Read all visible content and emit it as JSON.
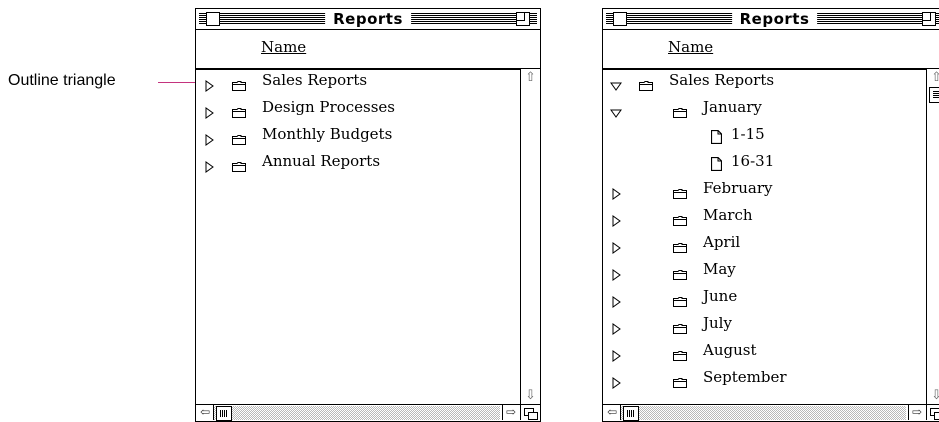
{
  "callout": {
    "label": "Outline triangle",
    "line_color": "#c4337e"
  },
  "window1": {
    "title": "Reports",
    "column_header": "Name",
    "rows": [
      {
        "label": "Sales Reports",
        "type": "folder",
        "expanded": false,
        "depth": 0
      },
      {
        "label": "Design Processes",
        "type": "folder",
        "expanded": false,
        "depth": 0
      },
      {
        "label": "Monthly Budgets",
        "type": "folder",
        "expanded": false,
        "depth": 0
      },
      {
        "label": "Annual Reports",
        "type": "folder",
        "expanded": false,
        "depth": 0
      }
    ]
  },
  "window2": {
    "title": "Reports",
    "column_header": "Name",
    "rows": [
      {
        "label": "Sales Reports",
        "type": "folder",
        "expanded": true,
        "depth": 0
      },
      {
        "label": "January",
        "type": "folder",
        "expanded": true,
        "depth": 1
      },
      {
        "label": "1-15",
        "type": "document",
        "depth": 2
      },
      {
        "label": "16-31",
        "type": "document",
        "depth": 2
      },
      {
        "label": "February",
        "type": "folder",
        "expanded": false,
        "depth": 1
      },
      {
        "label": "March",
        "type": "folder",
        "expanded": false,
        "depth": 1
      },
      {
        "label": "April",
        "type": "folder",
        "expanded": false,
        "depth": 1
      },
      {
        "label": "May",
        "type": "folder",
        "expanded": false,
        "depth": 1
      },
      {
        "label": "June",
        "type": "folder",
        "expanded": false,
        "depth": 1
      },
      {
        "label": "July",
        "type": "folder",
        "expanded": false,
        "depth": 1
      },
      {
        "label": "August",
        "type": "folder",
        "expanded": false,
        "depth": 1
      },
      {
        "label": "September",
        "type": "folder",
        "expanded": false,
        "depth": 1
      }
    ]
  },
  "icons": {
    "collapsed": "outline-triangle-right-icon",
    "expanded": "outline-triangle-down-icon",
    "folder": "folder-icon",
    "document": "document-icon"
  }
}
